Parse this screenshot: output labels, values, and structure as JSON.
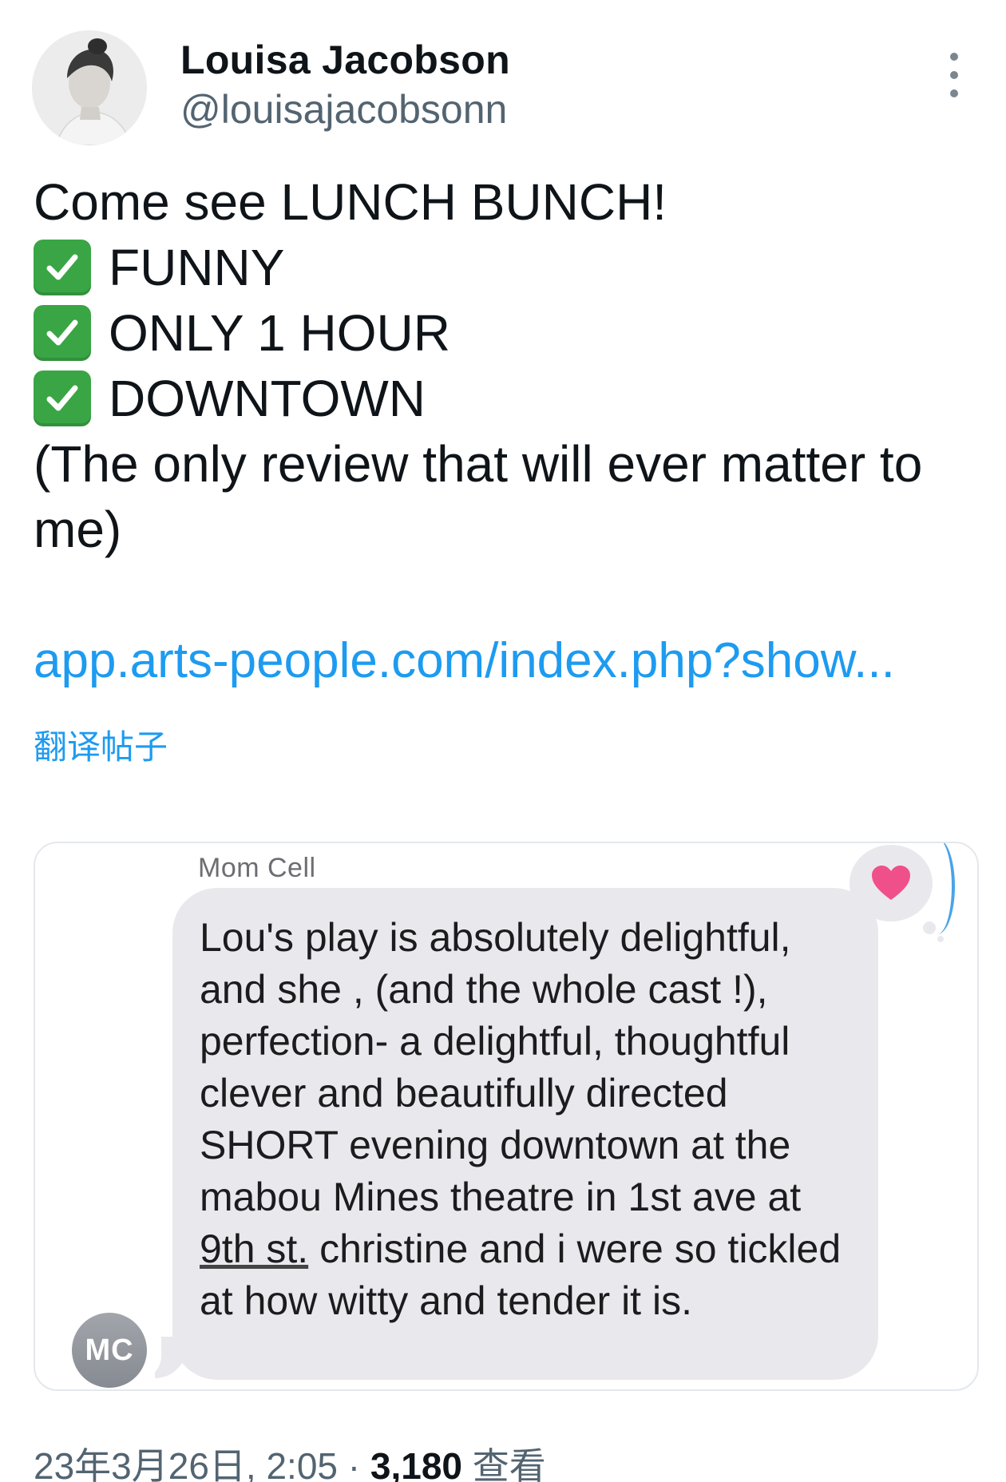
{
  "author": {
    "display_name": "Louisa Jacobson",
    "handle": "@louisajacobsonn"
  },
  "tweet": {
    "lines": [
      "Come see LUNCH BUNCH!",
      "FUNNY",
      "ONLY 1 HOUR",
      "DOWNTOWN",
      "(The only review that will ever matter to me)"
    ],
    "link_text": "app.arts-people.com/index.php?show...",
    "translate_label": "翻译帖子"
  },
  "media": {
    "sender_label": "Mom Cell",
    "avatar_initials": "MC",
    "message_parts": {
      "before": "Lou's play is absolutely delightful, and she , (and the whole cast !), perfection- a delightful, thoughtful clever and beautifully directed SHORT evening downtown at the mabou Mines theatre in 1st ave at ",
      "underlined": "9th st.",
      "after": " christine and i were so tickled at how witty and tender it is."
    },
    "reaction_icon": "heart-icon"
  },
  "footer": {
    "timestamp": "23年3月26日, 2:05",
    "separator": " · ",
    "views_count": "3,180",
    "views_label": " 查看"
  },
  "colors": {
    "link": "#1d9bf0",
    "secondary_text": "#536471",
    "check_green": "#3aa545",
    "heart_pink": "#f0508a",
    "bubble_gray": "#e9e9ed"
  }
}
